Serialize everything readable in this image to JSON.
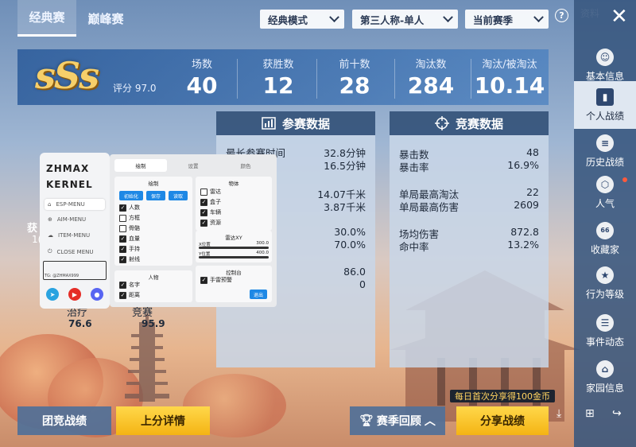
{
  "tabs": {
    "classic": "经典赛",
    "peak": "巅峰赛"
  },
  "filters": {
    "mode": "经典模式",
    "view": "第三人称-单人",
    "season": "当前赛季"
  },
  "resource_label": "资料",
  "rank": {
    "grade": "sSs",
    "score": "评分 97.0"
  },
  "summary_stats": [
    {
      "label": "场数",
      "value": "40"
    },
    {
      "label": "获胜数",
      "value": "12"
    },
    {
      "label": "前十数",
      "value": "28"
    },
    {
      "label": "淘汰数",
      "value": "284"
    },
    {
      "label": "淘汰/被淘汰",
      "value": "10.14"
    }
  ],
  "participation_panel": {
    "title": "参赛数据",
    "rows": [
      {
        "label": "最长参赛时间",
        "value": "32.8分钟"
      },
      {
        "label": "间",
        "value": "16.5分钟"
      },
      {
        "label": "离",
        "value": "14.07千米"
      },
      {
        "label": "离",
        "value": "3.87千米"
      },
      {
        "label": "",
        "value": "30.0%"
      },
      {
        "label": "",
        "value": "70.0%"
      },
      {
        "label": "",
        "value": "86.0"
      },
      {
        "label": "",
        "value": "0"
      }
    ]
  },
  "combat_panel": {
    "title": "竞赛数据",
    "rows": [
      {
        "label": "暴击数",
        "value": "48"
      },
      {
        "label": "暴击率",
        "value": "16.9%"
      },
      {
        "label": "单局最高淘汰",
        "value": "22"
      },
      {
        "label": "单局最高伤害",
        "value": "2609"
      },
      {
        "label": "场均伤害",
        "value": "872.8"
      },
      {
        "label": "命中率",
        "value": "13.2%"
      }
    ]
  },
  "left_stats": {
    "cut_label": "获",
    "cut_value": "1(",
    "heal_label": "治疗",
    "heal_value": "76.6",
    "compete_label": "竞赛",
    "compete_value": "95.9"
  },
  "mod_menu": {
    "brand": "ZHMAX KERNEL",
    "nav": [
      "ESP-MENU",
      "AIM-MENU",
      "ITEM-MENU",
      "CLOSE MENU"
    ],
    "tg": "TG: @ZHMAX999",
    "tabs": [
      "绘制",
      "设置",
      "颜色"
    ],
    "draw_title": "绘制",
    "buttons": [
      "初始化",
      "保存",
      "读取"
    ],
    "draw_checks": [
      "人数",
      "方框",
      "骨骼",
      "血量",
      "手持",
      "射线"
    ],
    "person_title": "人物",
    "person_checks": [
      "名字",
      "距离"
    ],
    "object_title": "物体",
    "object_checks": [
      "雷达",
      "盒子",
      "车辆",
      "资源"
    ],
    "radar_title": "雷达XY",
    "x_label": "X位置",
    "x_value": "300.0",
    "y_label": "Y位置",
    "y_value": "400.0",
    "control_title": "控制台",
    "control_check": "手雷预警",
    "exit_button": "退出"
  },
  "bottom": {
    "team": "团竞战绩",
    "rank_up": "上分详情",
    "season_review": "赛季回顾",
    "share": "分享战绩",
    "share_tip": "每日首次分享得100金币"
  },
  "sidebar": [
    {
      "label": "基本信息",
      "icon": "user-circle-icon"
    },
    {
      "label": "个人战绩",
      "icon": "bar-chart-icon",
      "active": true
    },
    {
      "label": "历史战绩",
      "icon": "history-doc-icon"
    },
    {
      "label": "人气",
      "icon": "hexagon-icon"
    },
    {
      "label": "收藏家",
      "icon": "badge-66-icon"
    },
    {
      "label": "行为等级",
      "icon": "shield-star-icon"
    },
    {
      "label": "事件动态",
      "icon": "news-icon"
    },
    {
      "label": "家园信息",
      "icon": "home-icon"
    }
  ],
  "colors": {
    "accent_yellow": "#f6cf6a",
    "panel_blue": "#34527a",
    "button_yellow": "#ffd84a"
  }
}
